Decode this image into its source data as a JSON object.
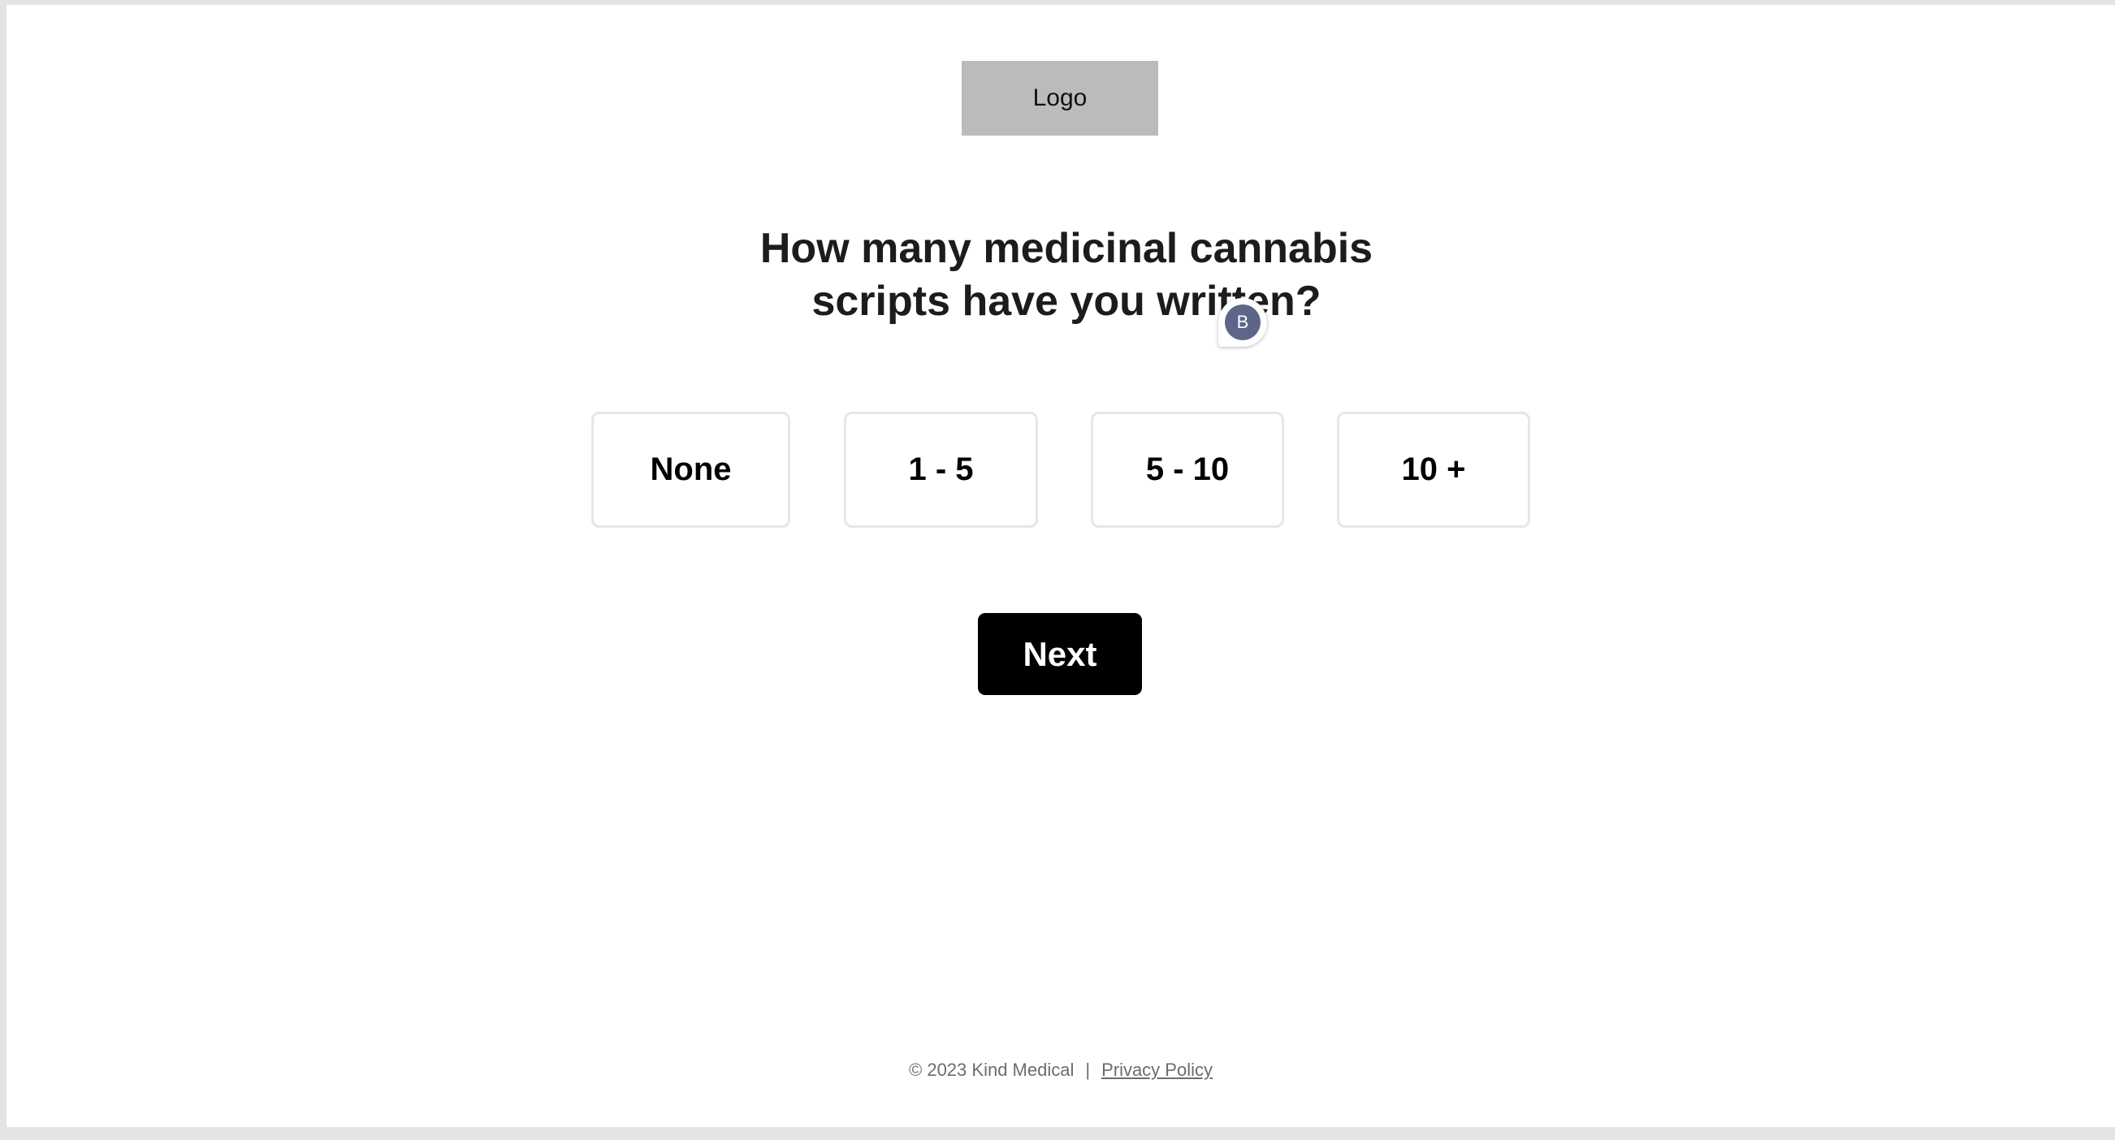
{
  "logo": {
    "label": "Logo"
  },
  "question": {
    "line1": "How many medicinal cannabis",
    "line2": "scripts have you written?"
  },
  "options": [
    {
      "label": "None"
    },
    {
      "label": "1 - 5"
    },
    {
      "label": "5 - 10"
    },
    {
      "label": "10 +"
    }
  ],
  "next_button": {
    "label": "Next"
  },
  "comment_pin": {
    "initial": "B",
    "avatar_color": "#5d6588"
  },
  "footer": {
    "copyright": "© 2023 Kind Medical",
    "separator": "|",
    "privacy_link": "Privacy Policy"
  },
  "colors": {
    "page_background": "#ffffff",
    "frame_background": "#e4e4e4",
    "logo_placeholder": "#bbbbbb",
    "primary_button": "#000000",
    "option_border": "#e6e6e6"
  }
}
